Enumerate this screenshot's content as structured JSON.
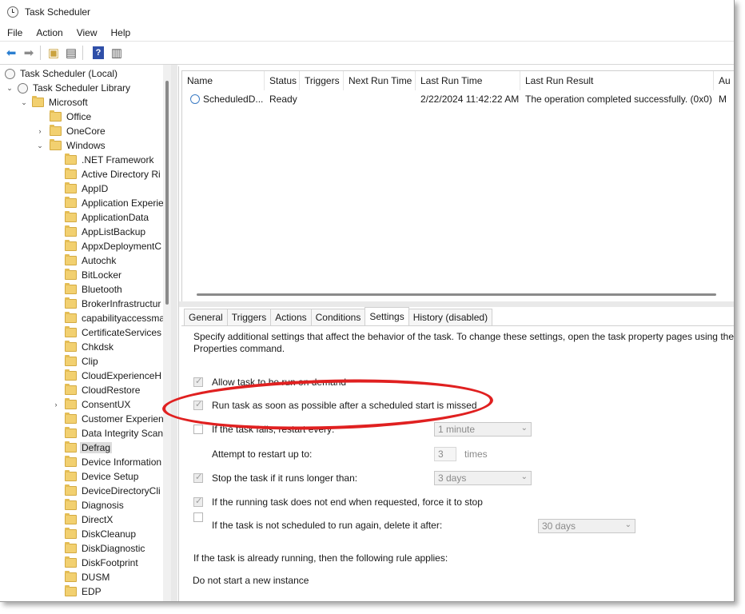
{
  "window": {
    "title": "Task Scheduler"
  },
  "menu": [
    "File",
    "Action",
    "View",
    "Help"
  ],
  "toolbar": {
    "buttons": [
      {
        "icon": "back-arrow-icon"
      },
      {
        "icon": "forward-arrow-icon"
      },
      {
        "icon": "up-folder-icon"
      },
      {
        "icon": "show-hide-console-tree-icon"
      },
      {
        "icon": "help-icon",
        "glyph": "?"
      },
      {
        "icon": "show-hide-action-pane-icon"
      }
    ]
  },
  "tree": {
    "root": "Task Scheduler (Local)",
    "library": "Task Scheduler Library",
    "microsoft": "Microsoft",
    "office": "Office",
    "onecore": "OneCore",
    "windows": "Windows",
    "children": [
      ".NET Framework",
      "Active Directory Ri",
      "AppID",
      "Application Experie",
      "ApplicationData",
      "AppListBackup",
      "AppxDeploymentC",
      "Autochk",
      "BitLocker",
      "Bluetooth",
      "BrokerInfrastructur",
      "capabilityaccessma",
      "CertificateServices",
      "Chkdsk",
      "Clip",
      "CloudExperienceH",
      "CloudRestore",
      "ConsentUX",
      "Customer Experien",
      "Data Integrity Scan",
      "Defrag",
      "Device Information",
      "Device Setup",
      "DeviceDirectoryCli",
      "Diagnosis",
      "DirectX",
      "DiskCleanup",
      "DiskDiagnostic",
      "DiskFootprint",
      "DUSM",
      "EDP"
    ],
    "selected_index": 20,
    "expandable_index": 17
  },
  "task_list": {
    "columns": [
      "Name",
      "Status",
      "Triggers",
      "Next Run Time",
      "Last Run Time",
      "Last Run Result",
      "Au"
    ],
    "rows": [
      {
        "name": "ScheduledD...",
        "status": "Ready",
        "triggers": "",
        "next_run": "",
        "last_run": "2/22/2024 11:42:22 AM",
        "result": "The operation completed successfully. (0x0)",
        "author": "M"
      }
    ]
  },
  "tabs": [
    "General",
    "Triggers",
    "Actions",
    "Conditions",
    "Settings",
    "History (disabled)"
  ],
  "active_tab": "Settings",
  "settings": {
    "description": "Specify additional settings that affect the behavior of the task. To change these settings, open the task property pages using the\nProperties command.",
    "allow_on_demand": "Allow task to be run on demand",
    "run_missed": "Run task as soon as possible after a scheduled start is missed",
    "restart_if_fails": "If the task fails, restart every:",
    "restart_interval": "1 minute",
    "attempt_restart": "Attempt to restart up to:",
    "attempt_count": "3",
    "attempt_unit": "times",
    "stop_if_longer": "Stop the task if it runs longer than:",
    "stop_duration": "3 days",
    "force_stop": "If the running task does not end when requested, force it to stop",
    "delete_if_not_scheduled": "If the task is not scheduled to run again, delete it after:",
    "delete_after": "30 days",
    "rule_heading": "If the task is already running, then the following rule applies:",
    "rule_value": "Do not start a new instance"
  },
  "annotation_color": "#e02020"
}
